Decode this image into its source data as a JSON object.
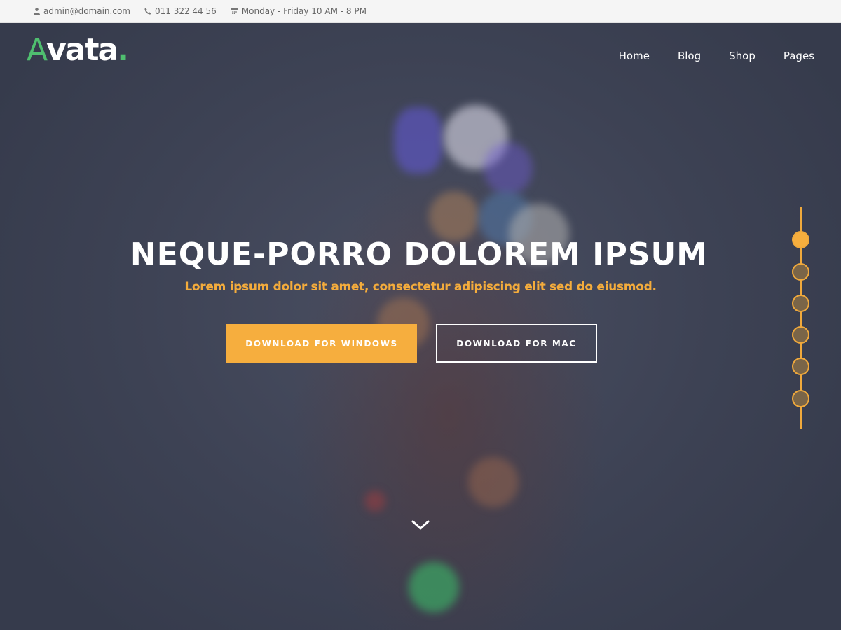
{
  "topbar": {
    "email": "admin@domain.com",
    "phone": "011 322 44 56",
    "hours": "Monday - Friday 10 AM - 8 PM"
  },
  "logo": {
    "first_letter": "A",
    "rest": "vata",
    "dot": "."
  },
  "nav": {
    "items": [
      {
        "label": "Home"
      },
      {
        "label": "Blog"
      },
      {
        "label": "Shop"
      },
      {
        "label": "Pages"
      }
    ]
  },
  "hero": {
    "title": "NEQUE-PORRO DOLOREM IPSUM",
    "subtitle": "Lorem ipsum dolor sit amet, consectetur adipiscing elit sed do eiusmod.",
    "primary_button": "DOWNLOAD FOR WINDOWS",
    "secondary_button": "DOWNLOAD FOR MAC",
    "scroll_icon": "chevron-down-icon"
  },
  "slider": {
    "dot_count": 6,
    "active_index": 0
  },
  "colors": {
    "accent": "#f6ae3e",
    "brand_green": "#4fbf6f",
    "hero_bg": "#3d4254",
    "topbar_bg": "#f5f5f5"
  }
}
